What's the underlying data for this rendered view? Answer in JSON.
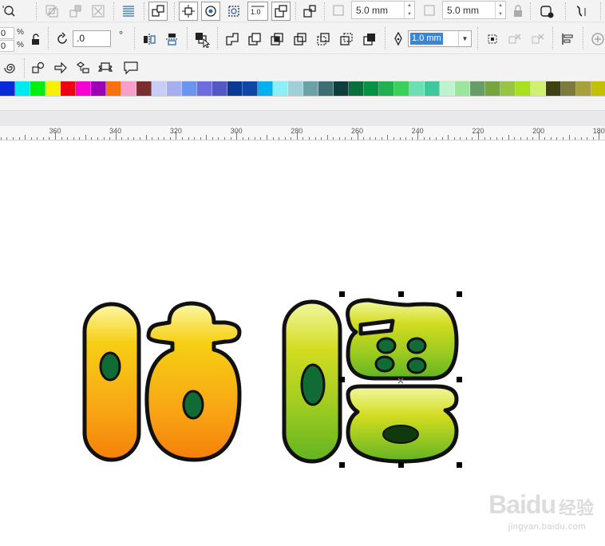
{
  "toolbar_top": {
    "corner_size_1": "5.0 mm",
    "corner_size_2": "5.0 mm",
    "icons": [
      "zoom-icon",
      "weld-icon",
      "trim-icon",
      "intersect-icon",
      "align-icon",
      "group-icon",
      "ungroup-icon",
      "combine-icon",
      "break-apart-icon",
      "convert-icon",
      "corner-icon",
      "lock-icon",
      "wrap-icon",
      "quick-trace-icon"
    ]
  },
  "property_bar": {
    "scale_x_value": "0",
    "scale_y_value": "0",
    "scale_x_unit": "%",
    "scale_y_unit": "%",
    "rotation_value": ".0",
    "degree_symbol": "°",
    "outline_width": "1.0 mm",
    "icons": [
      "lock-ratio-icon",
      "rotate-icon",
      "mirror-horizontal-icon",
      "mirror-vertical-icon",
      "to-front-icon",
      "weld-icon",
      "trim-icon",
      "intersect-icon",
      "simplify-icon",
      "front-minus-back-icon",
      "back-minus-front-icon",
      "boundary-icon",
      "pen-icon",
      "align-distribute-icon",
      "add-icon"
    ]
  },
  "toolbox_row": {
    "icons": [
      "spiral-icon",
      "basic-shapes-icon",
      "arrow-shapes-icon",
      "flowchart-shapes-icon",
      "banner-shapes-icon",
      "callout-shapes-icon"
    ]
  },
  "palette": {
    "colors": [
      "#0a2ad8",
      "#00e8f0",
      "#00ee11",
      "#f7f000",
      "#ef0012",
      "#f500d0",
      "#9b00b4",
      "#f97010",
      "#f79fca",
      "#7a2e2e",
      "#c6cdf6",
      "#a6aeee",
      "#6a94f0",
      "#6f6ce0",
      "#5458c5",
      "#0a3b93",
      "#0f46a7",
      "#00b0ef",
      "#8ceef6",
      "#9fd0d6",
      "#6aa2a6",
      "#3d6e71",
      "#0e3f3c",
      "#0a6f3a",
      "#079142",
      "#21b04f",
      "#3bd059",
      "#6ce0b2",
      "#3fc99a",
      "#bff3cd",
      "#9ae69f",
      "#6a9c6a",
      "#77a340",
      "#97c442",
      "#a8e020",
      "#d0f070",
      "#3e4212",
      "#7c7a3f",
      "#a8a03a",
      "#c2c000"
    ]
  },
  "ruler": {
    "labels": [
      "360",
      "340",
      "320",
      "300",
      "280",
      "260",
      "240",
      "220",
      "200",
      "180"
    ]
  },
  "artwork": {
    "left_group_gradient": [
      "#fcf8a6",
      "#f6cf14",
      "#f8a414",
      "#f57f0a"
    ],
    "right_group_gradient": [
      "#f2f8a0",
      "#d2dc20",
      "#a0cc20",
      "#62b422"
    ],
    "outline_color": "#111111",
    "eye_color": "#106b34",
    "selected_object": "right-glyph"
  },
  "watermark": {
    "brand": "Baidu",
    "brand_sub": "经验",
    "url": "jingyan.baidu.com"
  }
}
